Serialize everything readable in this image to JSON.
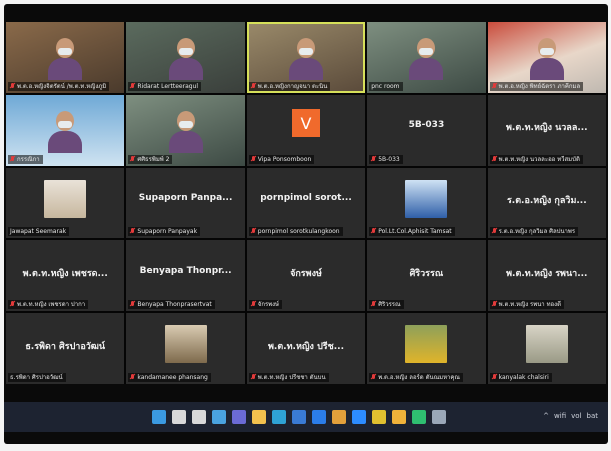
{
  "participants": [
    {
      "name": "พ.ต.อ.หญิงจิตรัตน์ /พ.ต.ท.หญิงภูมิ",
      "type": "video",
      "style": "photo warm",
      "muted": true
    },
    {
      "name": "Ridarat Lertteeragul",
      "type": "video",
      "style": "photo",
      "muted": true
    },
    {
      "name": "พ.ต.อ.หญิงกาญจนา ตะนิน",
      "type": "video",
      "style": "photo room",
      "muted": true,
      "active": true
    },
    {
      "name": "pnc room",
      "type": "video",
      "style": "photo lib",
      "muted": false
    },
    {
      "name": "พ.ต.อ.หญิง พิทย์ฉัตรา ภาคีกมล",
      "type": "video",
      "style": "photo red",
      "muted": true
    },
    {
      "name": "กรรณิกา",
      "type": "video",
      "style": "photo sky",
      "muted": true
    },
    {
      "name": "ศศิธรพิมพ์ 2",
      "type": "video",
      "style": "photo lib",
      "muted": true
    },
    {
      "name": "Vipa Ponsomboon",
      "type": "avatar-letter",
      "letter": "V",
      "muted": true
    },
    {
      "name": "5B-033",
      "type": "name-only",
      "display": "5B-033",
      "muted": true
    },
    {
      "name": "พ.ต.ท.หญิง นวลละออ ทวีสมบัติ",
      "type": "name-only",
      "display": "พ.ต.ท.หญิง นวลล...",
      "muted": true
    },
    {
      "name": "Jawapat Seemarak",
      "type": "photo-thumb",
      "thumb": "p1",
      "muted": false
    },
    {
      "name": "Supaporn Panpayak",
      "type": "name-only",
      "display": "Supaporn Panpa...",
      "muted": true
    },
    {
      "name": "pornpimol sorotkulangkoon",
      "type": "name-only",
      "display": "pornpimol sorot...",
      "muted": true
    },
    {
      "name": "Pol.Lt.Col.Aphisit Tamsat",
      "type": "photo-thumb",
      "thumb": "p2",
      "muted": true
    },
    {
      "name": "ร.ต.อ.หญิง กุลวิมล ศิลปนาพร",
      "type": "name-only",
      "display": "ร.ต.อ.หญิง กุลวิม...",
      "muted": true
    },
    {
      "name": "พ.ต.ท.หญิง เพชรดา ปากา",
      "type": "name-only",
      "display": "พ.ต.ท.หญิง เพชรด...",
      "muted": true
    },
    {
      "name": "Benyapa Thonprasertvat",
      "type": "name-only",
      "display": "Benyapa Thonpr...",
      "muted": true
    },
    {
      "name": "จักรพงษ์",
      "type": "name-only",
      "display": "จักรพงษ์",
      "muted": true
    },
    {
      "name": "ศิริวรรณ",
      "type": "name-only",
      "display": "ศิริวรรณ",
      "muted": true
    },
    {
      "name": "พ.ต.ท.หญิง รพนา ทองดี",
      "type": "name-only",
      "display": "พ.ต.ท.หญิง รพนา...",
      "muted": true
    },
    {
      "name": "ธ.รพิดา ศิรปาอวัฒน์",
      "type": "name-only",
      "display": "ธ.รพิดา ศิรปาอวัฒน์",
      "muted": false
    },
    {
      "name": "kandamanee phansang",
      "type": "photo-thumb",
      "thumb": "p3",
      "muted": true
    },
    {
      "name": "พ.ต.ท.หญิง ปรีชชา ตันบน",
      "type": "name-only",
      "display": "พ.ต.ท.หญิง ปรีช...",
      "muted": true
    },
    {
      "name": "พ.ต.อ.หญิง ลอร์ด ตันณมหาคุณ",
      "type": "photo-thumb",
      "thumb": "p4",
      "muted": true
    },
    {
      "name": "kanyalak chalsiri",
      "type": "photo-thumb",
      "thumb": "p5",
      "muted": true
    }
  ],
  "taskbar": {
    "icons": [
      "start-icon",
      "search-icon",
      "task-view-icon",
      "widgets-icon",
      "chat-icon",
      "explorer-icon",
      "edge-icon",
      "store-icon",
      "mail-icon",
      "app-icon",
      "zoom-icon",
      "chrome-icon",
      "files-icon",
      "meet-icon",
      "settings-icon"
    ],
    "icon_colors": [
      "#3b9ae1",
      "#d8d8d8",
      "#d8d8d8",
      "#4aa3e0",
      "#6b6bd6",
      "#f2c14e",
      "#2fa3d6",
      "#3a7bd5",
      "#2b7de9",
      "#e2a03b",
      "#2d8cff",
      "#e0c030",
      "#f0b23a",
      "#2fbf71",
      "#9aa7b8"
    ],
    "tray": [
      "^",
      "wifi",
      "vol",
      "bat"
    ]
  }
}
